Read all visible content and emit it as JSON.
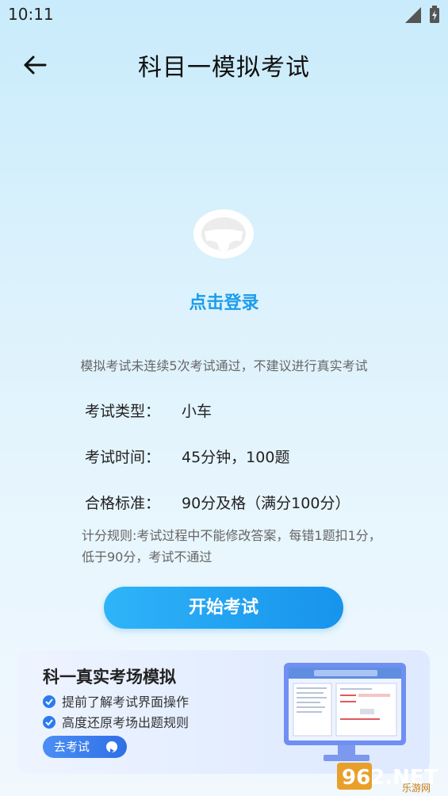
{
  "status_bar": {
    "time": "10:11"
  },
  "header": {
    "title": "科目一模拟考试"
  },
  "login": {
    "label": "点击登录"
  },
  "warning": "模拟考试未连续5次考试通过，不建议进行真实考试",
  "exam_info": [
    {
      "label": "考试类型：",
      "value": "小车"
    },
    {
      "label": "考试时间：",
      "value": "45分钟，100题"
    },
    {
      "label": "合格标准：",
      "value": "90分及格（满分100分）"
    }
  ],
  "rule": "计分规则:考试过程中不能修改答案，每错1题扣1分，低于90分，考试不通过",
  "start_button": "开始考试",
  "banner": {
    "title": "科一真实考场模拟",
    "features": [
      "提前了解考试界面操作",
      "高度还原考场出题规则"
    ],
    "button": "去考试"
  },
  "watermark": {
    "text": "962.NET",
    "subtext": "乐游网"
  },
  "colors": {
    "accent": "#1c9cec",
    "button_start": "#2fb4f8",
    "button_end": "#1793ec"
  }
}
